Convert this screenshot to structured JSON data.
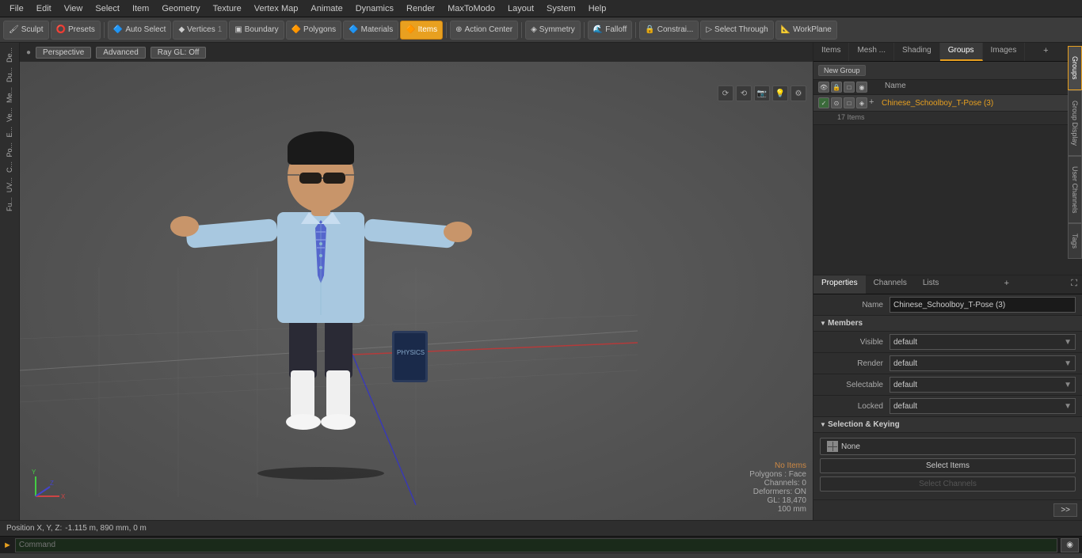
{
  "menu": {
    "items": [
      "File",
      "Edit",
      "View",
      "Select",
      "Item",
      "Geometry",
      "Texture",
      "Vertex Map",
      "Animate",
      "Dynamics",
      "Render",
      "MaxToModo",
      "Layout",
      "System",
      "Help"
    ]
  },
  "toolbar": {
    "sculpt_label": "Sculpt",
    "presets_label": "Presets",
    "auto_select_label": "Auto Select",
    "vertices_label": "Vertices",
    "boundary_label": "Boundary",
    "polygons_label": "Polygons",
    "materials_label": "Materials",
    "items_label": "Items",
    "action_center_label": "Action Center",
    "symmetry_label": "Symmetry",
    "falloff_label": "Falloff",
    "constrai_label": "Constrai...",
    "select_through_label": "Select Through",
    "workplane_label": "WorkPlane"
  },
  "viewport": {
    "perspective_label": "Perspective",
    "advanced_label": "Advanced",
    "ray_gl_label": "Ray GL: Off",
    "info": {
      "no_items": "No Items",
      "polygons": "Polygons : Face",
      "channels": "Channels: 0",
      "deformers": "Deformers: ON",
      "gl": "GL: 18,470",
      "mm": "100 mm"
    }
  },
  "right_panel": {
    "tabs": [
      "Items",
      "Mesh ...",
      "Shading",
      "Groups",
      "Images"
    ],
    "active_tab": "Groups",
    "groups_btn": "New Group",
    "col_headers": [
      "",
      "Name"
    ],
    "group": {
      "name": "Chinese_Schoolboy_T-Pose (3)",
      "count": "17 Items"
    }
  },
  "properties": {
    "tabs": [
      "Properties",
      "Channels",
      "Lists"
    ],
    "active_tab": "Properties",
    "name_label": "Name",
    "name_value": "Chinese_Schoolboy_T-Pose (3)",
    "members_label": "Members",
    "visible_label": "Visible",
    "visible_value": "default",
    "render_label": "Render",
    "render_value": "default",
    "selectable_label": "Selectable",
    "selectable_value": "default",
    "locked_label": "Locked",
    "locked_value": "default",
    "sel_keying_label": "Selection & Keying",
    "none_label": "None",
    "select_items_label": "Select Items",
    "select_channels_label": "Select Channels"
  },
  "side_tabs": [
    "Groups",
    "Group Display",
    "User Channels",
    "Tags"
  ],
  "command_bar": {
    "prompt_label": "►",
    "command_label": "Command",
    "placeholder": "Command"
  },
  "coords": {
    "label": "Position X, Y, Z:",
    "values": "-1.115 m, 890 mm, 0 m"
  },
  "left_tools": [
    "De...",
    "Du...",
    "Me...",
    "Ve...",
    "E...",
    "Po...",
    "C...",
    "UV...",
    "Fu..."
  ]
}
